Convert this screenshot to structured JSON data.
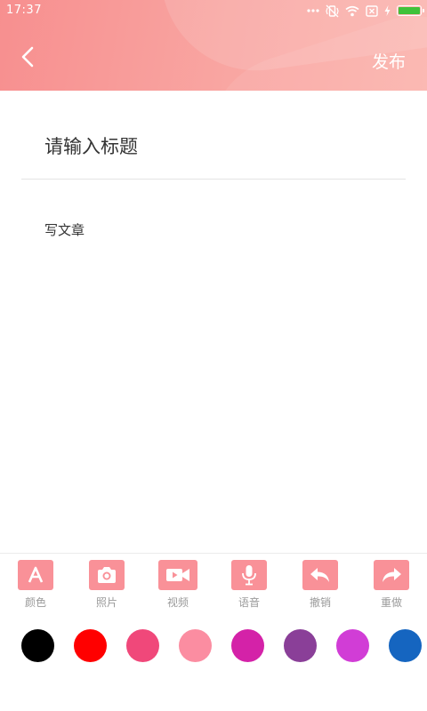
{
  "status_bar": {
    "time": "17:37"
  },
  "header": {
    "publish_label": "发布"
  },
  "editor": {
    "title_placeholder": "请输入标题",
    "body_text": "写文章"
  },
  "toolbar": {
    "items": [
      {
        "label": "颜色",
        "icon": "text-color-icon"
      },
      {
        "label": "照片",
        "icon": "camera-icon"
      },
      {
        "label": "视频",
        "icon": "video-icon"
      },
      {
        "label": "语音",
        "icon": "microphone-icon"
      },
      {
        "label": "撤销",
        "icon": "undo-icon"
      },
      {
        "label": "重做",
        "icon": "redo-icon"
      }
    ]
  },
  "colors": [
    "#000000",
    "#ff0000",
    "#f0487a",
    "#fb8da1",
    "#d422a8",
    "#8a3f98",
    "#d13dd6",
    "#1565c0"
  ]
}
